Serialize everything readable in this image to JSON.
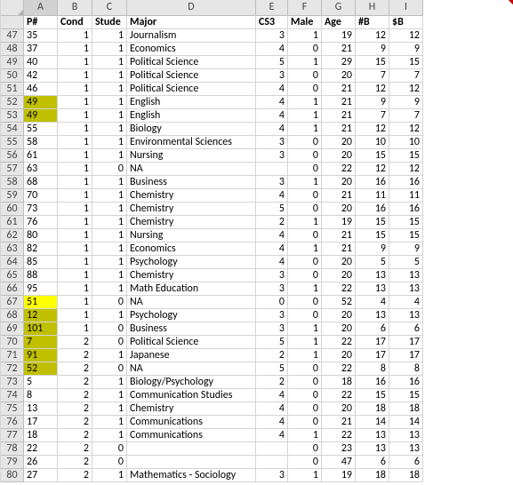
{
  "columns": [
    "A",
    "B",
    "C",
    "D",
    "E",
    "F",
    "G",
    "H",
    "I"
  ],
  "headers": {
    "A": "P#",
    "B": "Cond",
    "C": "Stude",
    "D": "Major",
    "E": "CS3",
    "F": "Male",
    "G": "Age",
    "H": "#B",
    "I": "$B"
  },
  "header_tri": [
    "A",
    "B",
    "E"
  ],
  "selected_col": "A",
  "rows": [
    {
      "n": 47,
      "A": "35",
      "B": "1",
      "C": "1",
      "D": "Journalism",
      "E": "3",
      "F": "1",
      "G": "19",
      "H": "12",
      "I": "12"
    },
    {
      "n": 48,
      "A": "37",
      "B": "1",
      "C": "1",
      "D": "Economics",
      "E": "4",
      "F": "0",
      "G": "21",
      "H": "9",
      "I": "9"
    },
    {
      "n": 49,
      "A": "40",
      "B": "1",
      "C": "1",
      "D": "Political Science",
      "E": "5",
      "F": "1",
      "G": "29",
      "H": "15",
      "I": "15"
    },
    {
      "n": 50,
      "A": "42",
      "B": "1",
      "C": "1",
      "D": "Political Science",
      "E": "3",
      "F": "0",
      "G": "20",
      "H": "7",
      "I": "7"
    },
    {
      "n": 51,
      "A": "46",
      "B": "1",
      "C": "1",
      "D": "Political Science",
      "E": "4",
      "F": "0",
      "G": "21",
      "H": "12",
      "I": "12"
    },
    {
      "n": 52,
      "A": "49",
      "B": "1",
      "C": "1",
      "D": "English",
      "E": "4",
      "F": "1",
      "G": "21",
      "H": "9",
      "I": "9",
      "hl": "o"
    },
    {
      "n": 53,
      "A": "49",
      "B": "1",
      "C": "1",
      "D": "English",
      "E": "4",
      "F": "1",
      "G": "21",
      "H": "7",
      "I": "7",
      "hl": "o"
    },
    {
      "n": 54,
      "A": "55",
      "B": "1",
      "C": "1",
      "D": "Biology",
      "E": "4",
      "F": "1",
      "G": "21",
      "H": "12",
      "I": "12"
    },
    {
      "n": 55,
      "A": "58",
      "B": "1",
      "C": "1",
      "D": "Environmental Sciences",
      "E": "3",
      "F": "0",
      "G": "20",
      "H": "10",
      "I": "10"
    },
    {
      "n": 56,
      "A": "61",
      "B": "1",
      "C": "1",
      "D": "Nursing",
      "E": "3",
      "F": "0",
      "G": "20",
      "H": "15",
      "I": "15"
    },
    {
      "n": 57,
      "A": "63",
      "B": "1",
      "C": "0",
      "D": "NA",
      "E": "",
      "F": "0",
      "G": "22",
      "H": "12",
      "I": "12"
    },
    {
      "n": 58,
      "A": "68",
      "B": "1",
      "C": "1",
      "D": "Business",
      "E": "3",
      "F": "1",
      "G": "20",
      "H": "16",
      "I": "16"
    },
    {
      "n": 59,
      "A": "70",
      "B": "1",
      "C": "1",
      "D": "Chemistry",
      "E": "4",
      "F": "0",
      "G": "21",
      "H": "11",
      "I": "11"
    },
    {
      "n": 60,
      "A": "73",
      "B": "1",
      "C": "1",
      "D": "Chemistry",
      "E": "5",
      "F": "0",
      "G": "20",
      "H": "16",
      "I": "16"
    },
    {
      "n": 61,
      "A": "76",
      "B": "1",
      "C": "1",
      "D": "Chemistry",
      "E": "2",
      "F": "1",
      "G": "19",
      "H": "15",
      "I": "15"
    },
    {
      "n": 62,
      "A": "80",
      "B": "1",
      "C": "1",
      "D": "Nursing",
      "E": "4",
      "F": "0",
      "G": "21",
      "H": "15",
      "I": "15"
    },
    {
      "n": 63,
      "A": "82",
      "B": "1",
      "C": "1",
      "D": "Economics",
      "E": "4",
      "F": "1",
      "G": "21",
      "H": "9",
      "I": "9"
    },
    {
      "n": 64,
      "A": "85",
      "B": "1",
      "C": "1",
      "D": "Psychology",
      "E": "4",
      "F": "0",
      "G": "20",
      "H": "5",
      "I": "5"
    },
    {
      "n": 65,
      "A": "88",
      "B": "1",
      "C": "1",
      "D": "Chemistry",
      "E": "3",
      "F": "0",
      "G": "20",
      "H": "13",
      "I": "13"
    },
    {
      "n": 66,
      "A": "95",
      "B": "1",
      "C": "1",
      "D": "Math Education",
      "E": "3",
      "F": "1",
      "G": "22",
      "H": "13",
      "I": "13"
    },
    {
      "n": 67,
      "A": "51",
      "B": "1",
      "C": "0",
      "D": "NA",
      "E": "0",
      "F": "0",
      "G": "52",
      "H": "4",
      "I": "4",
      "hl": "y"
    },
    {
      "n": 68,
      "A": "12",
      "B": "1",
      "C": "1",
      "D": "Psychology",
      "E": "3",
      "F": "0",
      "G": "20",
      "H": "13",
      "I": "13",
      "hl": "o"
    },
    {
      "n": 69,
      "A": "101",
      "B": "1",
      "C": "0",
      "D": "Business",
      "E": "3",
      "F": "1",
      "G": "20",
      "H": "6",
      "I": "6",
      "hl": "o"
    },
    {
      "n": 70,
      "A": "7",
      "B": "2",
      "C": "0",
      "D": "Political Science",
      "E": "5",
      "F": "1",
      "G": "22",
      "H": "17",
      "I": "17",
      "hl": "o"
    },
    {
      "n": 71,
      "A": "91",
      "B": "2",
      "C": "1",
      "D": "Japanese",
      "E": "2",
      "F": "1",
      "G": "20",
      "H": "17",
      "I": "17",
      "hl": "o"
    },
    {
      "n": 72,
      "A": "52",
      "B": "2",
      "C": "0",
      "D": "NA",
      "E": "5",
      "F": "0",
      "G": "22",
      "H": "8",
      "I": "8",
      "hl": "o"
    },
    {
      "n": 73,
      "A": "5",
      "B": "2",
      "C": "1",
      "D": "Biology/Psychology",
      "E": "2",
      "F": "0",
      "G": "18",
      "H": "16",
      "I": "16"
    },
    {
      "n": 74,
      "A": "8",
      "B": "2",
      "C": "1",
      "D": "Communication Studies",
      "E": "4",
      "F": "0",
      "G": "22",
      "H": "15",
      "I": "15"
    },
    {
      "n": 75,
      "A": "13",
      "B": "2",
      "C": "1",
      "D": "Chemistry",
      "E": "4",
      "F": "0",
      "G": "20",
      "H": "18",
      "I": "18"
    },
    {
      "n": 76,
      "A": "17",
      "B": "2",
      "C": "1",
      "D": "Communications",
      "E": "4",
      "F": "0",
      "G": "21",
      "H": "14",
      "I": "14"
    },
    {
      "n": 77,
      "A": "18",
      "B": "2",
      "C": "1",
      "D": "Communications",
      "E": "4",
      "F": "1",
      "G": "22",
      "H": "13",
      "I": "13"
    },
    {
      "n": 78,
      "A": "22",
      "B": "2",
      "C": "0",
      "D": "",
      "E": "",
      "F": "0",
      "G": "23",
      "H": "13",
      "I": "13"
    },
    {
      "n": 79,
      "A": "26",
      "B": "2",
      "C": "0",
      "D": "",
      "E": "",
      "F": "0",
      "G": "47",
      "H": "6",
      "I": "6"
    },
    {
      "n": 80,
      "A": "27",
      "B": "2",
      "C": "1",
      "D": "Mathematics - Sociology",
      "E": "3",
      "F": "1",
      "G": "19",
      "H": "18",
      "I": "18"
    }
  ]
}
